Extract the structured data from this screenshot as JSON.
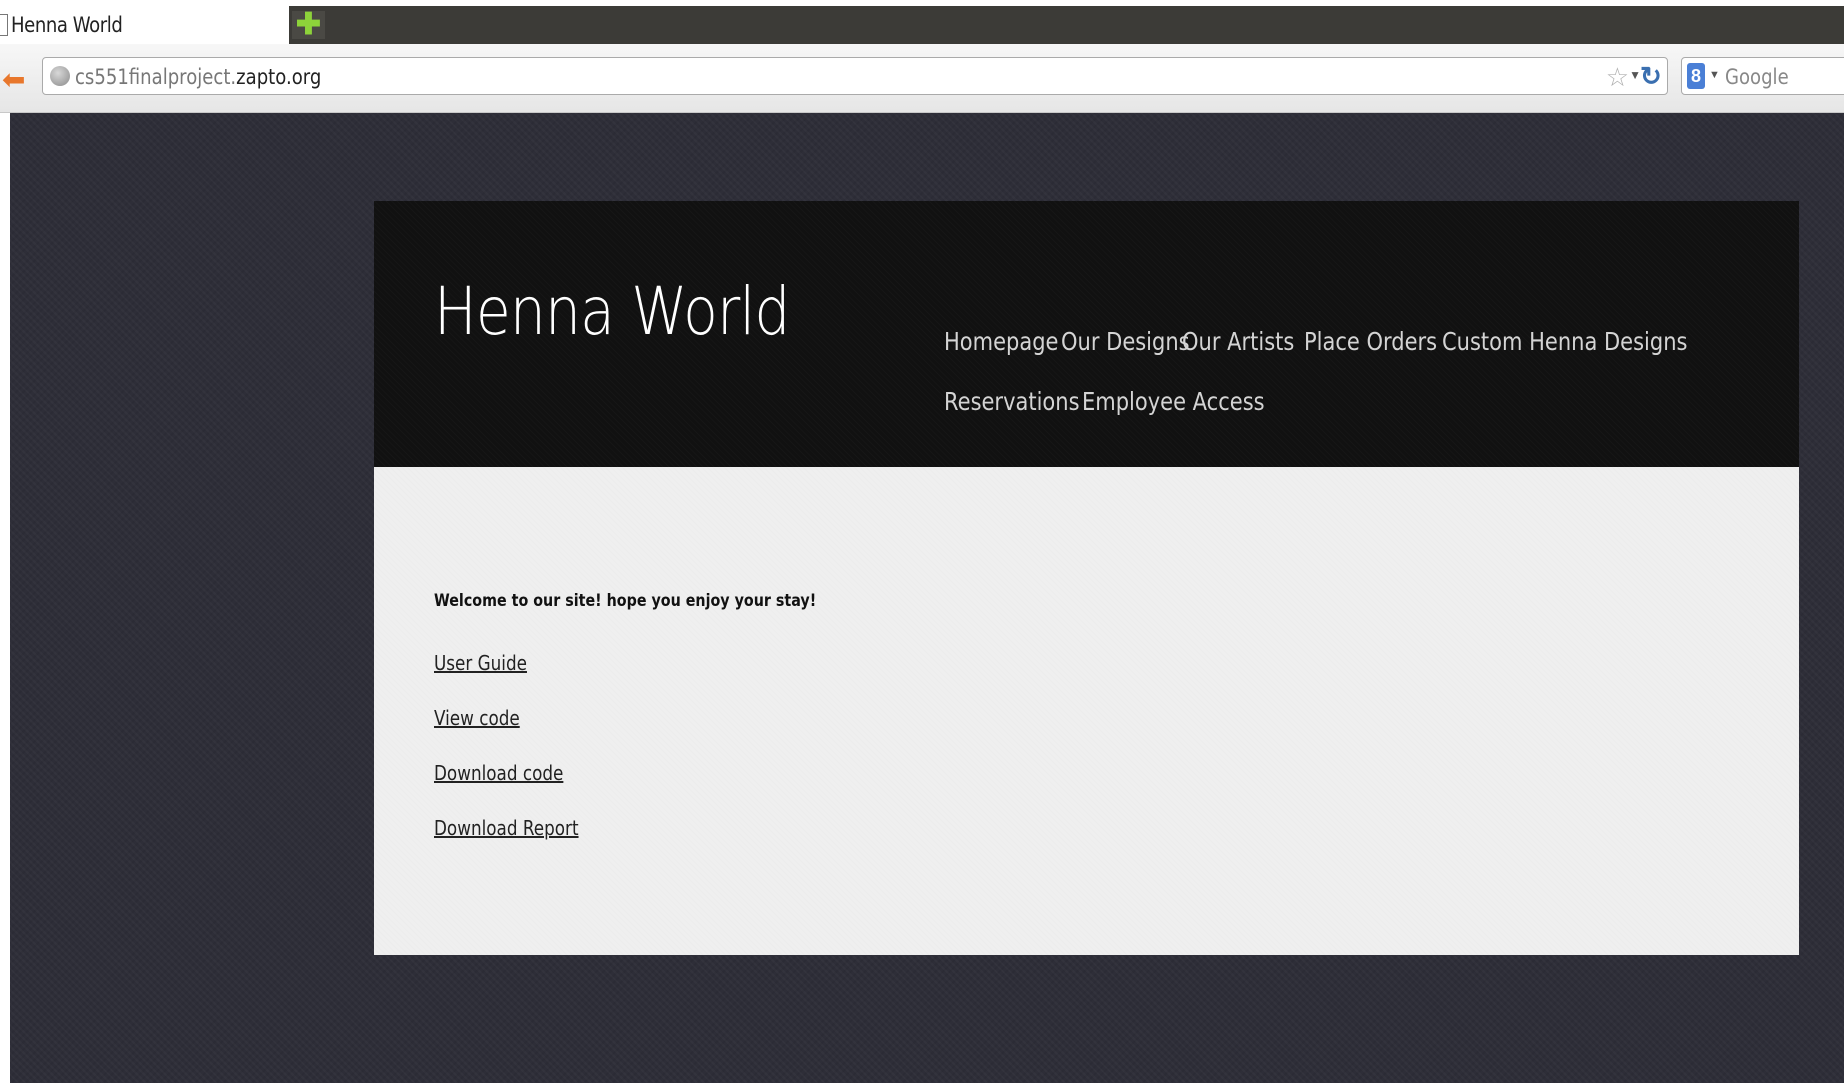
{
  "browser": {
    "tab_title": "Henna World",
    "new_tab_symbol": "✚",
    "url_prefix": "cs551finalproject.",
    "url_host": "zapto.org",
    "search_engine_letter": "8",
    "search_placeholder": "Google",
    "icons": {
      "back": "back-arrow-icon",
      "site": "globe-icon",
      "bookmark": "star-icon",
      "reload": "reload-icon",
      "search_engine": "google-icon"
    },
    "colors": {
      "tabstrip": "#3c3b37",
      "new_tab_plus": "#8dd33a",
      "back_arrow": "#e8772c"
    }
  },
  "site": {
    "title": "Henna World",
    "nav": [
      [
        "Homepage",
        "Our Designs",
        "Our Artists",
        "Place Orders",
        "Custom Henna Designs"
      ],
      [
        "Reservations",
        "Employee Access"
      ]
    ],
    "welcome": "Welcome to our site! hope you enjoy your stay!",
    "links": [
      "User Guide",
      "View code",
      "Download code",
      "Download Report"
    ],
    "colors": {
      "background": "#2e2e38",
      "header": "#111111",
      "body": "#efefef",
      "nav_text": "#d4d4d4"
    }
  }
}
